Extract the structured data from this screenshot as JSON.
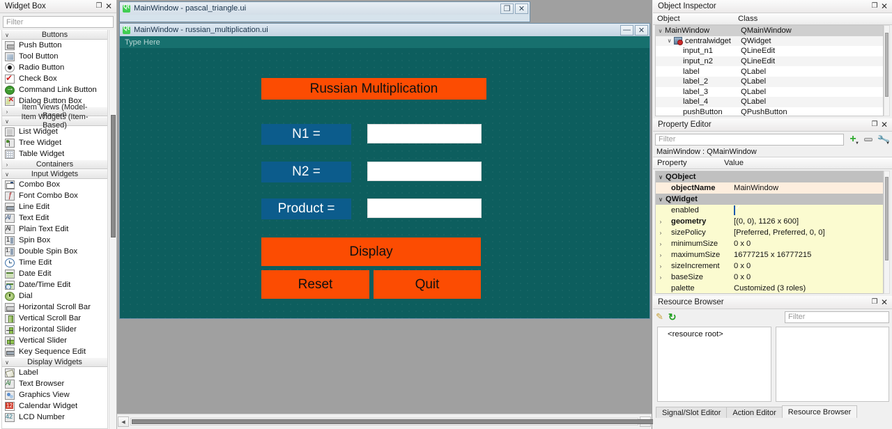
{
  "widget_box": {
    "title": "Widget Box",
    "filter_placeholder": "Filter",
    "groups": [
      {
        "name": "Buttons",
        "expanded": true,
        "items": [
          {
            "label": "Push Button",
            "icon": "push-button-icon"
          },
          {
            "label": "Tool Button",
            "icon": "tool-button-icon"
          },
          {
            "label": "Radio Button",
            "icon": "radio-button-icon"
          },
          {
            "label": "Check Box",
            "icon": "check-box-icon"
          },
          {
            "label": "Command Link Button",
            "icon": "command-link-button-icon"
          },
          {
            "label": "Dialog Button Box",
            "icon": "dialog-button-box-icon"
          }
        ]
      },
      {
        "name": "Item Views (Model-Based)",
        "expanded": false,
        "items": []
      },
      {
        "name": "Item Widgets (Item-Based)",
        "expanded": true,
        "items": [
          {
            "label": "List Widget",
            "icon": "list-widget-icon"
          },
          {
            "label": "Tree Widget",
            "icon": "tree-widget-icon"
          },
          {
            "label": "Table Widget",
            "icon": "table-widget-icon"
          }
        ]
      },
      {
        "name": "Containers",
        "expanded": false,
        "items": []
      },
      {
        "name": "Input Widgets",
        "expanded": true,
        "items": [
          {
            "label": "Combo Box",
            "icon": "combo-box-icon"
          },
          {
            "label": "Font Combo Box",
            "icon": "font-combo-box-icon"
          },
          {
            "label": "Line Edit",
            "icon": "line-edit-icon"
          },
          {
            "label": "Text Edit",
            "icon": "text-edit-icon"
          },
          {
            "label": "Plain Text Edit",
            "icon": "plain-text-edit-icon"
          },
          {
            "label": "Spin Box",
            "icon": "spin-box-icon"
          },
          {
            "label": "Double Spin Box",
            "icon": "double-spin-box-icon"
          },
          {
            "label": "Time Edit",
            "icon": "time-edit-icon"
          },
          {
            "label": "Date Edit",
            "icon": "date-edit-icon"
          },
          {
            "label": "Date/Time Edit",
            "icon": "date-time-edit-icon"
          },
          {
            "label": "Dial",
            "icon": "dial-icon"
          },
          {
            "label": "Horizontal Scroll Bar",
            "icon": "horizontal-scroll-bar-icon"
          },
          {
            "label": "Vertical Scroll Bar",
            "icon": "vertical-scroll-bar-icon"
          },
          {
            "label": "Horizontal Slider",
            "icon": "horizontal-slider-icon"
          },
          {
            "label": "Vertical Slider",
            "icon": "vertical-slider-icon"
          },
          {
            "label": "Key Sequence Edit",
            "icon": "key-sequence-edit-icon"
          }
        ]
      },
      {
        "name": "Display Widgets",
        "expanded": true,
        "items": [
          {
            "label": "Label",
            "icon": "label-icon"
          },
          {
            "label": "Text Browser",
            "icon": "text-browser-icon"
          },
          {
            "label": "Graphics View",
            "icon": "graphics-view-icon"
          },
          {
            "label": "Calendar Widget",
            "icon": "calendar-widget-icon"
          },
          {
            "label": "LCD Number",
            "icon": "lcd-number-icon"
          }
        ]
      }
    ]
  },
  "mdi": {
    "window_back": {
      "title": "MainWindow - pascal_triangle.ui"
    },
    "window_front": {
      "title": "MainWindow - russian_multiplication.ui"
    }
  },
  "form": {
    "menubar_placeholder": "Type Here",
    "title_label": "Russian Multiplication",
    "label_n1": "N1 =",
    "label_n2": "N2 =",
    "label_product": "Product =",
    "input_n1_value": "",
    "input_n2_value": "",
    "input_product_value": "",
    "button_display": "Display",
    "button_reset": "Reset",
    "button_quit": "Quit",
    "colors": {
      "canvas": "#0d5e5e",
      "menubar": "#17706e",
      "accent_orange": "#fc4c02",
      "accent_blue": "#0c5c8c",
      "field_white": "#ffffff"
    }
  },
  "object_inspector": {
    "title": "Object Inspector",
    "columns": [
      "Object",
      "Class"
    ],
    "rows": [
      {
        "object": "MainWindow",
        "class": "QMainWindow",
        "depth": 0,
        "expandable": true,
        "selected": true,
        "has_icon": false
      },
      {
        "object": "centralwidget",
        "class": "QWidget",
        "depth": 1,
        "expandable": true,
        "selected": false,
        "has_icon": true
      },
      {
        "object": "input_n1",
        "class": "QLineEdit",
        "depth": 2,
        "expandable": false,
        "selected": false,
        "has_icon": false
      },
      {
        "object": "input_n2",
        "class": "QLineEdit",
        "depth": 2,
        "expandable": false,
        "selected": false,
        "has_icon": false
      },
      {
        "object": "label",
        "class": "QLabel",
        "depth": 2,
        "expandable": false,
        "selected": false,
        "has_icon": false
      },
      {
        "object": "label_2",
        "class": "QLabel",
        "depth": 2,
        "expandable": false,
        "selected": false,
        "has_icon": false
      },
      {
        "object": "label_3",
        "class": "QLabel",
        "depth": 2,
        "expandable": false,
        "selected": false,
        "has_icon": false
      },
      {
        "object": "label_4",
        "class": "QLabel",
        "depth": 2,
        "expandable": false,
        "selected": false,
        "has_icon": false
      },
      {
        "object": "pushButton",
        "class": "QPushButton",
        "depth": 2,
        "expandable": false,
        "selected": false,
        "has_icon": false
      }
    ]
  },
  "property_editor": {
    "title": "Property Editor",
    "filter_placeholder": "Filter",
    "object_line": "MainWindow : QMainWindow",
    "columns": [
      "Property",
      "Value"
    ],
    "rows": [
      {
        "kind": "group",
        "property": "QObject",
        "value": ""
      },
      {
        "kind": "prop",
        "property": "objectName",
        "value": "MainWindow",
        "bold": true,
        "expandable": false,
        "tone": "peach"
      },
      {
        "kind": "group",
        "property": "QWidget",
        "value": ""
      },
      {
        "kind": "prop",
        "property": "enabled",
        "value": "",
        "bold": false,
        "expandable": false,
        "tone": "yellow",
        "checkbox": true
      },
      {
        "kind": "prop",
        "property": "geometry",
        "value": "[(0, 0), 1126 x 600]",
        "bold": true,
        "expandable": true,
        "tone": "yellow"
      },
      {
        "kind": "prop",
        "property": "sizePolicy",
        "value": "[Preferred, Preferred, 0, 0]",
        "bold": false,
        "expandable": true,
        "tone": "yellow"
      },
      {
        "kind": "prop",
        "property": "minimumSize",
        "value": "0 x 0",
        "bold": false,
        "expandable": true,
        "tone": "yellow"
      },
      {
        "kind": "prop",
        "property": "maximumSize",
        "value": "16777215 x 16777215",
        "bold": false,
        "expandable": true,
        "tone": "yellow"
      },
      {
        "kind": "prop",
        "property": "sizeIncrement",
        "value": "0 x 0",
        "bold": false,
        "expandable": true,
        "tone": "yellow"
      },
      {
        "kind": "prop",
        "property": "baseSize",
        "value": "0 x 0",
        "bold": false,
        "expandable": true,
        "tone": "yellow"
      },
      {
        "kind": "prop",
        "property": "palette",
        "value": "Customized (3 roles)",
        "bold": false,
        "expandable": false,
        "tone": "yellow"
      }
    ]
  },
  "resource_browser": {
    "title": "Resource Browser",
    "filter_placeholder": "Filter",
    "tree_root": "<resource root>",
    "tabs": [
      {
        "label": "Signal/Slot Editor",
        "active": false
      },
      {
        "label": "Action Editor",
        "active": false
      },
      {
        "label": "Resource Browser",
        "active": true
      }
    ]
  }
}
